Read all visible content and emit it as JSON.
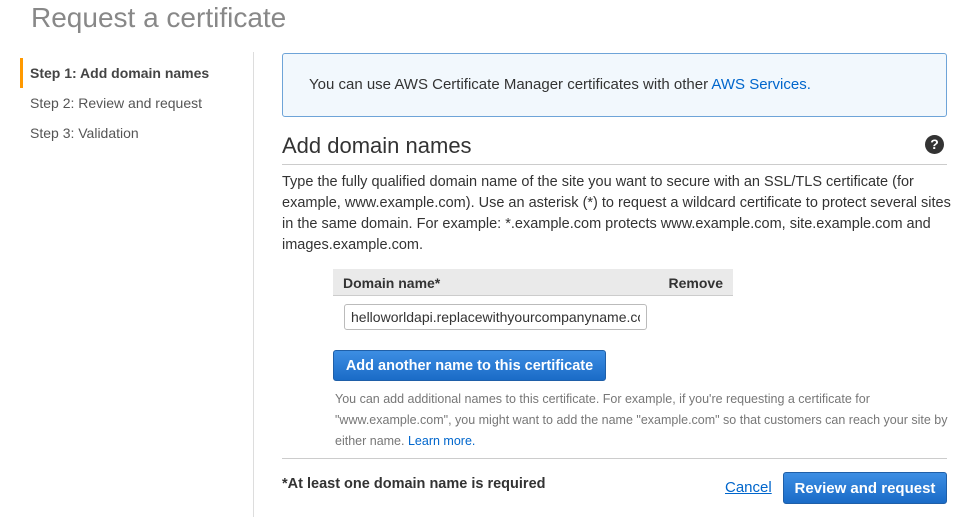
{
  "page_title": "Request a certificate",
  "steps": [
    {
      "label": "Step 1: Add domain names"
    },
    {
      "label": "Step 2: Review and request"
    },
    {
      "label": "Step 3: Validation"
    }
  ],
  "info": {
    "text": "You can use AWS Certificate Manager certificates with other ",
    "link": "AWS Services."
  },
  "section": {
    "title": "Add domain names",
    "help_icon": "?",
    "description": "Type the fully qualified domain name of the site you want to secure with an SSL/TLS certificate (for example, www.example.com). Use an asterisk (*) to request a wildcard certificate to protect several sites in the same domain. For example: *.example.com protects www.example.com, site.example.com and images.example.com."
  },
  "table": {
    "col_domain": "Domain name*",
    "col_remove": "Remove",
    "domain_value": "helloworldapi.replacewithyourcompanyname.com"
  },
  "add_button": "Add another name to this certificate",
  "note": {
    "text": "You can add additional names to this certificate. For example, if you're requesting a certificate for \"www.example.com\", you might want to add the name \"example.com\" so that customers can reach your site by either name. ",
    "link": "Learn more."
  },
  "footer": {
    "required": "*At least one domain name is required",
    "cancel": "Cancel",
    "review": "Review and request"
  }
}
